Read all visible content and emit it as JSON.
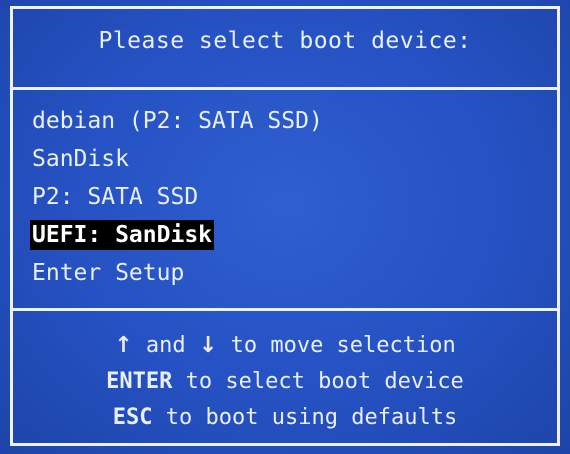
{
  "header": {
    "title": "Please select boot device:"
  },
  "menu": {
    "items": [
      {
        "label": "debian (P2: SATA SSD)",
        "selected": false
      },
      {
        "label": "SanDisk",
        "selected": false
      },
      {
        "label": "P2: SATA SSD",
        "selected": false
      },
      {
        "label": "UEFI: SanDisk",
        "selected": true
      },
      {
        "label": "Enter Setup",
        "selected": false
      }
    ]
  },
  "help": {
    "line1": {
      "up_arrow": "↑",
      "and": "and",
      "down_arrow": "↓",
      "rest": "to move selection"
    },
    "line2": {
      "key": "ENTER",
      "rest": "to select boot device"
    },
    "line3": {
      "key": "ESC",
      "rest": "to boot using defaults"
    }
  },
  "colors": {
    "background": "#2551c2",
    "border": "#eef2ff",
    "text": "#e9efff",
    "highlight_bg": "#000000"
  }
}
